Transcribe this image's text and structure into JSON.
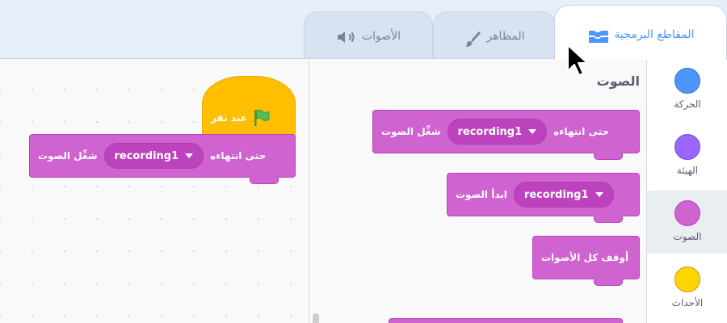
{
  "tabs": {
    "code": {
      "label": "المقاطع البرمجية",
      "icon": "code-blocks-icon"
    },
    "costumes": {
      "label": "المظاهر",
      "icon": "paintbrush-icon"
    },
    "sounds": {
      "label": "الأصوات",
      "icon": "speaker-icon"
    }
  },
  "categories": [
    {
      "label": "الحركة",
      "color": "#4c97ff"
    },
    {
      "label": "الهيئة",
      "color": "#9966ff"
    },
    {
      "label": "الصوت",
      "color": "#cf63cf",
      "selected": true
    },
    {
      "label": "الأحداث",
      "color": "#ffd500"
    }
  ],
  "palette": {
    "heading": "الصوت",
    "blocks": {
      "play_until_done": {
        "text_start": "شغِّل الصوت",
        "sound": "recording1",
        "text_end": "حتى انتهاءه"
      },
      "start_sound": {
        "text": "ابدأ الصوت",
        "sound": "recording1"
      },
      "stop_all": {
        "text": "أوقف كل الأصوات"
      }
    }
  },
  "workspace": {
    "hat": {
      "label": "عند نقر",
      "icon": "green-flag-icon"
    },
    "play_until_done": {
      "text_start": "شغِّل الصوت",
      "sound": "recording1",
      "text_end": "حتى انتهاءه"
    }
  },
  "colors": {
    "sound": "#cf63cf",
    "events": "#ffbf00",
    "accent": "#4c97ff"
  }
}
